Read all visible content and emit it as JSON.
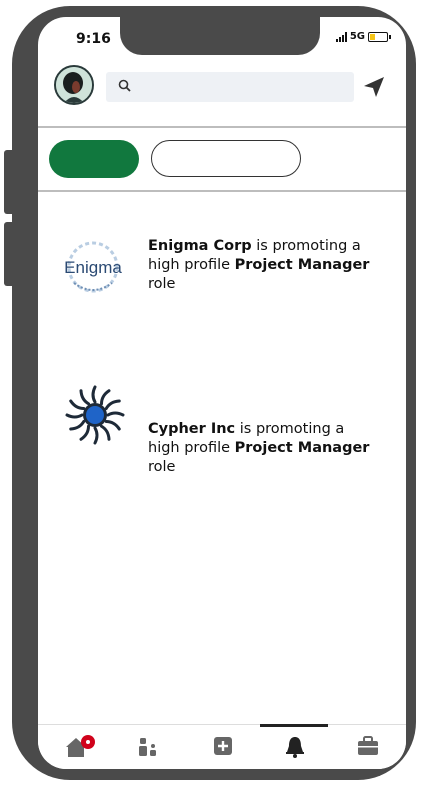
{
  "status_bar": {
    "time": "9:16",
    "network": "5G"
  },
  "search": {
    "placeholder": "",
    "value": ""
  },
  "tabs": [
    {
      "label": "",
      "active": true
    },
    {
      "label": "",
      "active": false
    }
  ],
  "notifications": [
    {
      "company": "Enigma Corp",
      "logo_text": "Enigma",
      "text_mid": " is promoting a high profile ",
      "role": "Project Manager",
      "text_end": " role"
    },
    {
      "company": "Cypher Inc",
      "text_mid": " is promoting a high profile ",
      "role": "Project Manager",
      "text_end": " role"
    }
  ],
  "bottom_nav": {
    "items": [
      "home-icon",
      "people-icon",
      "add-icon",
      "bell-icon",
      "briefcase-icon"
    ],
    "active": "bell-icon",
    "home_badge": true
  },
  "colors": {
    "accent": "#11783e",
    "badge": "#d0021b",
    "phone_frame": "#4a4a4a",
    "cypher_blue": "#1f64c8"
  }
}
